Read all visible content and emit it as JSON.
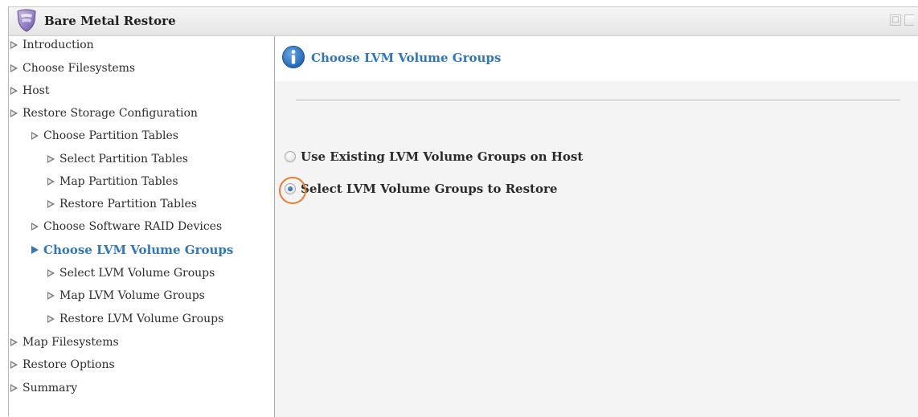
{
  "window": {
    "title": "Bare Metal Restore",
    "icon": "shield-icon",
    "buttons": [
      "restore-icon",
      "close-icon"
    ]
  },
  "nav": {
    "items": [
      {
        "label": "Introduction",
        "level": 0,
        "active": false
      },
      {
        "label": "Choose Filesystems",
        "level": 0,
        "active": false
      },
      {
        "label": "Host",
        "level": 0,
        "active": false
      },
      {
        "label": "Restore Storage Configuration",
        "level": 0,
        "active": false
      },
      {
        "label": "Choose Partition Tables",
        "level": 1,
        "active": false
      },
      {
        "label": "Select Partition Tables",
        "level": 2,
        "active": false
      },
      {
        "label": "Map Partition Tables",
        "level": 2,
        "active": false
      },
      {
        "label": "Restore Partition Tables",
        "level": 2,
        "active": false
      },
      {
        "label": "Choose Software RAID Devices",
        "level": 1,
        "active": false
      },
      {
        "label": "Choose LVM Volume Groups",
        "level": 1,
        "active": true
      },
      {
        "label": "Select LVM Volume Groups",
        "level": 2,
        "active": false
      },
      {
        "label": "Map LVM Volume Groups",
        "level": 2,
        "active": false
      },
      {
        "label": "Restore LVM Volume Groups",
        "level": 2,
        "active": false
      },
      {
        "label": "Map Filesystems",
        "level": 0,
        "active": false
      },
      {
        "label": "Restore Options",
        "level": 0,
        "active": false
      },
      {
        "label": "Summary",
        "level": 0,
        "active": false
      }
    ]
  },
  "main": {
    "title": "Choose LVM Volume Groups",
    "header_icon": "info-icon",
    "options": [
      {
        "label": "Use Existing LVM Volume Groups on Host",
        "checked": false
      },
      {
        "label": "Select LVM Volume Groups to Restore",
        "checked": true
      }
    ]
  },
  "colors": {
    "accent": "#2f77bd",
    "highlight_ring": "#e87b2e",
    "content_bg": "#f4f4f4"
  }
}
